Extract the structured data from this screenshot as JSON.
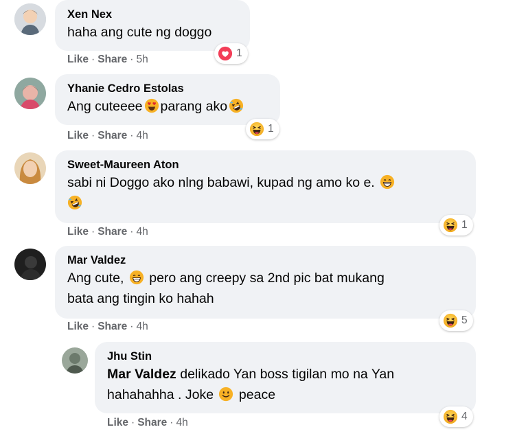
{
  "labels": {
    "like": "Like",
    "share": "Share",
    "dot": "·"
  },
  "comments": [
    {
      "name": "Xen Nex",
      "text": "haha ang cute ng doggo",
      "time": "5h",
      "reaction_icon": "heart-icon",
      "reaction_count": "1"
    },
    {
      "name": "Yhanie Cedro Estolas",
      "text_before": "Ang cuteeee",
      "text_middle": "parang ako",
      "time": "4h",
      "reaction_icon": "haha-icon",
      "reaction_count": "1"
    },
    {
      "name": "Sweet-Maureen Aton",
      "text": "sabi ni Doggo ako nlng babawi, kupad ng amo ko e.",
      "time": "4h",
      "reaction_icon": "haha-icon",
      "reaction_count": "1"
    },
    {
      "name": "Mar Valdez",
      "text_before": "Ang cute,",
      "text_line1_after": "pero ang creepy sa 2nd pic bat mukang",
      "text_line2": "bata ang tingin ko hahah",
      "time": "4h",
      "reaction_icon": "haha-icon",
      "reaction_count": "5"
    }
  ],
  "reply": {
    "name": "Jhu Stin",
    "mention": "Mar Valdez",
    "text_line1": "delikado Yan boss tigilan mo na Yan",
    "text_line2_before": "hahahahha . Joke",
    "text_line2_after": "peace",
    "time": "4h",
    "reaction_icon": "haha-icon",
    "reaction_count": "4"
  },
  "colors": {
    "bubble": "#f0f2f5",
    "meta": "#65676b",
    "heart": "#f33e58",
    "emoji_yellow": "#f7b125"
  }
}
